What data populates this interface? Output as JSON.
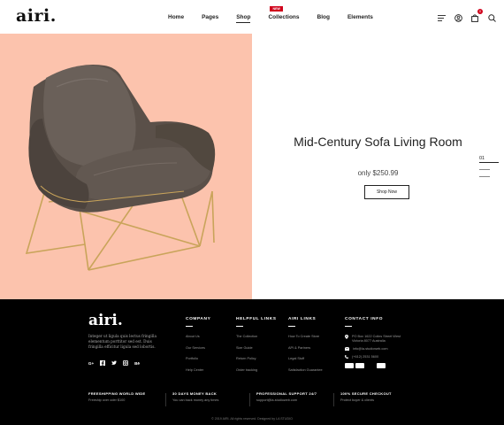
{
  "header": {
    "logo": "airi.",
    "nav": [
      {
        "label": "Home",
        "active": false
      },
      {
        "label": "Pages",
        "active": false
      },
      {
        "label": "Shop",
        "active": true
      },
      {
        "label": "Collections",
        "active": false,
        "badge": "NEW"
      },
      {
        "label": "Blog",
        "active": false
      },
      {
        "label": "Elements",
        "active": false
      }
    ],
    "icons": [
      "menu-icon",
      "user-icon",
      "cart-icon",
      "search-icon"
    ],
    "cart_count": "0"
  },
  "hero": {
    "title": "Mid-Century Sofa Living Room",
    "price": "only $250.99",
    "button_label": "Shop Now",
    "slide_number": "01",
    "background_color": "#fcc3ad"
  },
  "footer": {
    "logo": "airi.",
    "description": "Integer ut ligula quis lectus fringilla elementum porttitor sed est. Duis fringilla efficitur ligula sed lobortis.",
    "social_icons": [
      "google-plus-icon",
      "facebook-icon",
      "twitter-icon",
      "instagram-icon",
      "behance-icon"
    ],
    "columns": [
      {
        "title": "COMPANY",
        "links": [
          "About Us",
          "Our Services",
          "Portfolio",
          "Help Center"
        ]
      },
      {
        "title": "HELPFUL LINKS",
        "links": [
          "The Collection",
          "Size Guide",
          "Return Policy",
          "Order tracking"
        ]
      },
      {
        "title": "AIRI LINKS",
        "links": [
          "How To Create Store",
          "API & Partners",
          "Legal Stuff",
          "Satisfaction Guarantee"
        ]
      }
    ],
    "contact": {
      "title": "CONTACT INFO",
      "address": "PO Box 1622 Colins Street West Victoria 8077 Australia",
      "email": "info@la-studioweb.com",
      "phone": "(+612) 2531 5600"
    },
    "features": [
      {
        "title": "FREESHIPPING WORLD WIDE",
        "text": "Freeship over oder $100"
      },
      {
        "title": "30 DAYS MONEY BACK",
        "text": "You can back money any times"
      },
      {
        "title": "PROFESSIONAL SUPPORT 24/7",
        "text": "support@la-studioweb.com"
      },
      {
        "title": "100% SECURE CHECKOUT",
        "text": "Protect buyer & clients"
      }
    ],
    "copyright": "© 2019 AIRI. All rights reserved. Designed by LA STUDIO"
  }
}
